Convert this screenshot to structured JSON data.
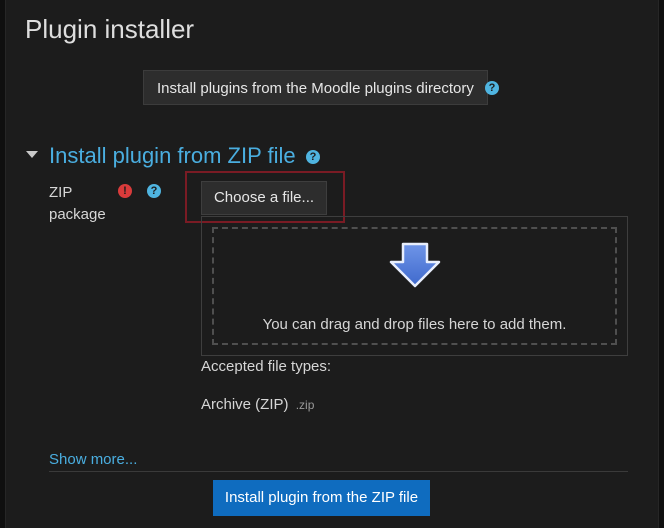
{
  "page": {
    "title": "Plugin installer"
  },
  "directory_button": {
    "label": "Install plugins from the Moodle plugins directory"
  },
  "section": {
    "title": "Install plugin from ZIP file"
  },
  "zip_field": {
    "label": "ZIP package",
    "choose_button": "Choose a file...",
    "drop_hint": "You can drag and drop files here to add them.",
    "accepted_label": "Accepted file types:",
    "accepted_type_name": "Archive (ZIP)",
    "accepted_type_ext": ".zip"
  },
  "show_more": "Show more...",
  "install_button": {
    "label": "Install plugin from the ZIP file"
  },
  "icons": {
    "help": "question-circle-icon",
    "required": "exclamation-circle-icon",
    "collapse": "caret-down-icon",
    "drop": "down-arrow-icon"
  },
  "colors": {
    "accent": "#4aaee0",
    "primary_button": "#0f6cbf",
    "required": "#d93b3b",
    "highlight_border": "#7a1b24"
  }
}
